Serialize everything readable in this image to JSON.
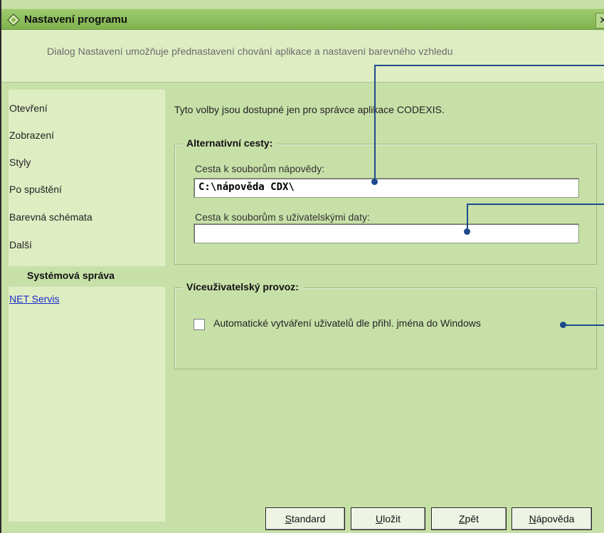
{
  "window": {
    "title": "Nastavení programu",
    "close": "✕"
  },
  "header": {
    "description": "Dialog Nastavení umožňuje přednastavení chování aplikace a nastavení barevného vzhledu"
  },
  "sidebar": {
    "items": [
      "Otevření",
      "Zobrazení",
      "Styly",
      "Po spuštění",
      "Barevná schémata",
      "Další"
    ],
    "selected": "Systémová správa",
    "link": "NET Servis"
  },
  "main": {
    "info": "Tyto volby jsou dostupné jen pro správce aplikace CODEXIS.",
    "paths_group": {
      "title": "Alternativní cesty:",
      "help_label": "Cesta k souborům nápovědy:",
      "help_value": "C:\\nápověda CDX\\",
      "user_label": "Cesta k souborům s uživatelskými daty:",
      "user_value": ""
    },
    "multiuser_group": {
      "title": "Víceuživatelský provoz:",
      "checkbox_label": "Automatické vytváření uživatelů dle přihl. jména do Windows",
      "checked": false
    }
  },
  "buttons": {
    "standard": {
      "mnemonic": "S",
      "rest": "tandard"
    },
    "save": {
      "mnemonic": "U",
      "rest": "ložit"
    },
    "back": {
      "mnemonic": "Z",
      "rest": "pět"
    },
    "help": {
      "mnemonic": "N",
      "rest": "ápověda"
    }
  },
  "colors": {
    "callout": "#1e4a8c",
    "link": "#1a2ec8"
  }
}
